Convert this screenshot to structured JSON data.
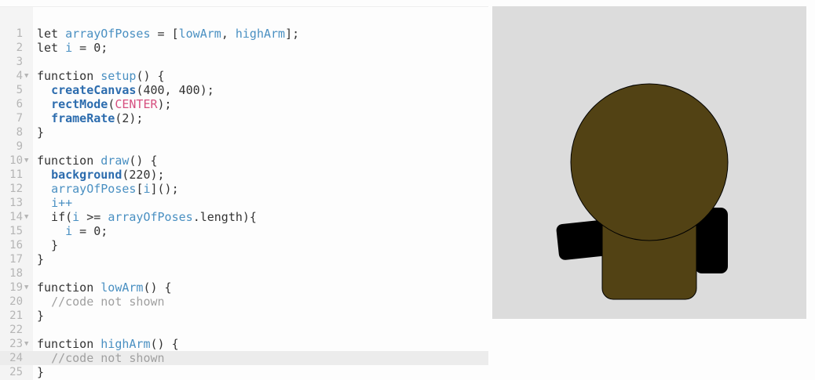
{
  "editor": {
    "active_line": 24,
    "lines": [
      {
        "n": "1",
        "fold": false,
        "tokens": [
          {
            "t": "let ",
            "c": "plain"
          },
          {
            "t": "arrayOfPoses",
            "c": "var"
          },
          {
            "t": " = [",
            "c": "plain"
          },
          {
            "t": "lowArm",
            "c": "var"
          },
          {
            "t": ", ",
            "c": "plain"
          },
          {
            "t": "highArm",
            "c": "var"
          },
          {
            "t": "];",
            "c": "plain"
          }
        ]
      },
      {
        "n": "2",
        "fold": false,
        "tokens": [
          {
            "t": "let ",
            "c": "plain"
          },
          {
            "t": "i",
            "c": "var"
          },
          {
            "t": " = 0;",
            "c": "plain"
          }
        ]
      },
      {
        "n": "3",
        "fold": false,
        "tokens": []
      },
      {
        "n": "4",
        "fold": true,
        "tokens": [
          {
            "t": "function ",
            "c": "plain"
          },
          {
            "t": "setup",
            "c": "var"
          },
          {
            "t": "() {",
            "c": "plain"
          }
        ]
      },
      {
        "n": "5",
        "fold": false,
        "tokens": [
          {
            "t": "  ",
            "c": "plain"
          },
          {
            "t": "createCanvas",
            "c": "fn"
          },
          {
            "t": "(400, 400);",
            "c": "plain"
          }
        ]
      },
      {
        "n": "6",
        "fold": false,
        "tokens": [
          {
            "t": "  ",
            "c": "plain"
          },
          {
            "t": "rectMode",
            "c": "fn"
          },
          {
            "t": "(",
            "c": "plain"
          },
          {
            "t": "CENTER",
            "c": "const"
          },
          {
            "t": ");",
            "c": "plain"
          }
        ]
      },
      {
        "n": "7",
        "fold": false,
        "tokens": [
          {
            "t": "  ",
            "c": "plain"
          },
          {
            "t": "frameRate",
            "c": "fn"
          },
          {
            "t": "(2);",
            "c": "plain"
          }
        ]
      },
      {
        "n": "8",
        "fold": false,
        "tokens": [
          {
            "t": "}",
            "c": "plain"
          }
        ]
      },
      {
        "n": "9",
        "fold": false,
        "tokens": []
      },
      {
        "n": "10",
        "fold": true,
        "tokens": [
          {
            "t": "function ",
            "c": "plain"
          },
          {
            "t": "draw",
            "c": "var"
          },
          {
            "t": "() {",
            "c": "plain"
          }
        ]
      },
      {
        "n": "11",
        "fold": false,
        "tokens": [
          {
            "t": "  ",
            "c": "plain"
          },
          {
            "t": "background",
            "c": "fn"
          },
          {
            "t": "(220);",
            "c": "plain"
          }
        ]
      },
      {
        "n": "12",
        "fold": false,
        "tokens": [
          {
            "t": "  ",
            "c": "plain"
          },
          {
            "t": "arrayOfPoses",
            "c": "var"
          },
          {
            "t": "[",
            "c": "plain"
          },
          {
            "t": "i",
            "c": "var"
          },
          {
            "t": "]();",
            "c": "plain"
          }
        ]
      },
      {
        "n": "13",
        "fold": false,
        "tokens": [
          {
            "t": "  ",
            "c": "plain"
          },
          {
            "t": "i++",
            "c": "var"
          }
        ]
      },
      {
        "n": "14",
        "fold": true,
        "tokens": [
          {
            "t": "  if(",
            "c": "plain"
          },
          {
            "t": "i",
            "c": "var"
          },
          {
            "t": " >= ",
            "c": "plain"
          },
          {
            "t": "arrayOfPoses",
            "c": "var"
          },
          {
            "t": ".length){",
            "c": "plain"
          }
        ]
      },
      {
        "n": "15",
        "fold": false,
        "tokens": [
          {
            "t": "    ",
            "c": "plain"
          },
          {
            "t": "i",
            "c": "var"
          },
          {
            "t": " = 0;",
            "c": "plain"
          }
        ]
      },
      {
        "n": "16",
        "fold": false,
        "tokens": [
          {
            "t": "  }",
            "c": "plain"
          }
        ]
      },
      {
        "n": "17",
        "fold": false,
        "tokens": [
          {
            "t": "}",
            "c": "plain"
          }
        ]
      },
      {
        "n": "18",
        "fold": false,
        "tokens": []
      },
      {
        "n": "19",
        "fold": true,
        "tokens": [
          {
            "t": "function ",
            "c": "plain"
          },
          {
            "t": "lowArm",
            "c": "var"
          },
          {
            "t": "() {",
            "c": "plain"
          }
        ]
      },
      {
        "n": "20",
        "fold": false,
        "tokens": [
          {
            "t": "  ",
            "c": "plain"
          },
          {
            "t": "//code not shown",
            "c": "comment"
          }
        ]
      },
      {
        "n": "21",
        "fold": false,
        "tokens": [
          {
            "t": "}",
            "c": "plain"
          }
        ]
      },
      {
        "n": "22",
        "fold": false,
        "tokens": []
      },
      {
        "n": "23",
        "fold": true,
        "tokens": [
          {
            "t": "function ",
            "c": "plain"
          },
          {
            "t": "highArm",
            "c": "var"
          },
          {
            "t": "() {",
            "c": "plain"
          }
        ]
      },
      {
        "n": "24",
        "fold": false,
        "tokens": [
          {
            "t": "  ",
            "c": "plain"
          },
          {
            "t": "//code not shown",
            "c": "comment"
          }
        ]
      },
      {
        "n": "25",
        "fold": false,
        "tokens": [
          {
            "t": "}",
            "c": "plain"
          }
        ]
      }
    ]
  },
  "preview": {
    "background_color": "#dcdcdc",
    "body_color": "#524214",
    "arm_color": "#000000",
    "outline_color": "#000000"
  }
}
